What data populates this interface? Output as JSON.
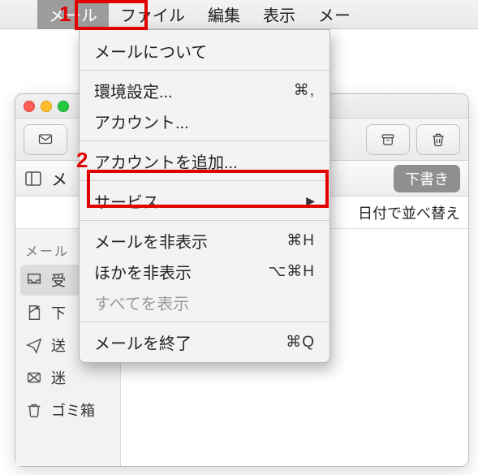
{
  "menubar": {
    "items": [
      "メール",
      "ファイル",
      "編集",
      "表示",
      "メー"
    ],
    "active_index": 0
  },
  "dropdown": {
    "about": "メールについて",
    "prefs": "環境設定...",
    "prefs_sc": "⌘,",
    "accounts": "アカウント...",
    "add_account": "アカウントを追加...",
    "services": "サービス",
    "hide_mail": "メールを非表示",
    "hide_mail_sc": "⌘H",
    "hide_others": "ほかを非表示",
    "hide_others_sc": "⌥⌘H",
    "show_all": "すべてを表示",
    "quit": "メールを終了",
    "quit_sc": "⌘Q"
  },
  "window": {
    "tab_label": "メ",
    "pill": "下書き",
    "sort_label": "日付で並べ替え"
  },
  "sidebar": {
    "heading": "メール",
    "items": [
      "受",
      "下",
      "送",
      "迷",
      "ゴミ箱"
    ]
  },
  "annotations": {
    "n1": "1",
    "n2": "2"
  }
}
